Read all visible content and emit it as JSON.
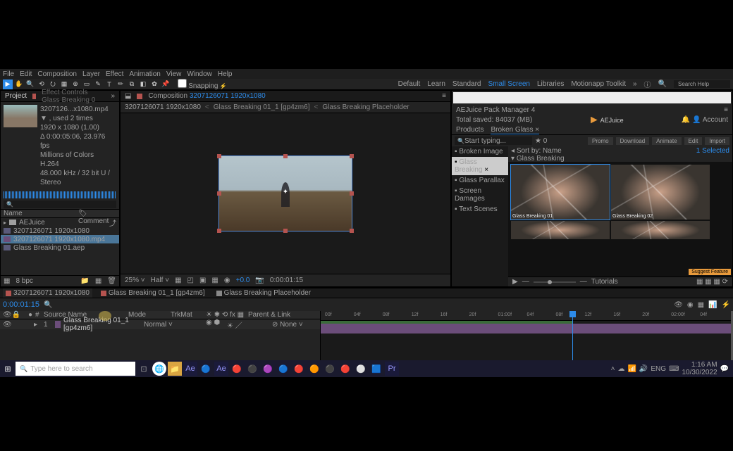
{
  "menu": {
    "file": "File",
    "edit": "Edit",
    "composition": "Composition",
    "layer": "Layer",
    "effect": "Effect",
    "animation": "Animation",
    "view": "View",
    "window": "Window",
    "help": "Help"
  },
  "workspace": {
    "default": "Default",
    "learn": "Learn",
    "standard": "Standard",
    "small_screen": "Small Screen",
    "libraries": "Libraries",
    "motionapp": "Motionapp Toolkit"
  },
  "search_help": "Search Help",
  "snapping": "Snapping",
  "project": {
    "tab1": "Project",
    "tab2": "Effect Controls Glass Breaking 0",
    "asset_name": "3207126...x1080.mp4 ▼ , used 2 times",
    "asset_res": "1920 x 1080 (1.00)",
    "asset_dur": "Δ 0:00:05:06, 23.976 fps",
    "asset_colors": "Millions of Colors",
    "asset_codec": "H.264",
    "asset_audio": "48.000 kHz / 32 bit U / Stereo",
    "col_name": "Name",
    "col_comment": "Comment",
    "items": [
      {
        "name": "AEJuice",
        "type": "folder"
      },
      {
        "name": "3207126071 1920x1080",
        "type": "comp"
      },
      {
        "name": "3207126071 1920x1080.mp4",
        "type": "video",
        "selected": true
      },
      {
        "name": "Glass Breaking 01.aep",
        "type": "comp"
      }
    ],
    "footer_bpc": "8 bpc"
  },
  "composition": {
    "tab_prefix": "Composition",
    "tab_name": "3207126071 1920x1080",
    "crumb1": "3207126071 1920x1080",
    "crumb2": "Glass Breaking 01_1 [gp4zm6]",
    "crumb3": "Glass Breaking Placeholder",
    "zoom": "25%",
    "res": "Half",
    "ratio": "+0.0",
    "timecode": "0:00:01:15"
  },
  "aejuice": {
    "title": "AEJuice Pack Manager 4",
    "savings": "Total saved: 84037 (MB)",
    "account": "Account",
    "tab_products": "Products",
    "tab_broken": "Broken Glass",
    "search_ph": "Start typing...",
    "star": "★ 0",
    "btn_promo": "Promo",
    "btn_download": "Download",
    "btn_animate": "Animate",
    "btn_edit": "Edit",
    "btn_import": "Import",
    "sidebar": [
      {
        "name": "Broken Image"
      },
      {
        "name": "Glass Breaking",
        "selected": true
      },
      {
        "name": "Glass Parallax"
      },
      {
        "name": "Screen Damages"
      },
      {
        "name": "Text Scenes"
      }
    ],
    "sort": "Sort by: Name",
    "group": "Glass Breaking",
    "selected": "1 Selected",
    "items": [
      "Glass Breaking 01",
      "Glass Breaking 02",
      "",
      ""
    ],
    "suggest": "Suggest Feature",
    "tutorials": "Tutorials"
  },
  "timeline": {
    "tabs": [
      {
        "name": "3207126071 1920x1080",
        "icon": "org",
        "active": true
      },
      {
        "name": "Glass Breaking 01_1 [gp4zm6]",
        "icon": "org"
      },
      {
        "name": "Glass Breaking Placeholder",
        "icon": "gry"
      }
    ],
    "timecode": "0:00:01:15",
    "col_source": "Source Name",
    "col_mode": "Mode",
    "col_trkmat": "TrkMat",
    "col_parent": "Parent & Link",
    "layer_num": "1",
    "layer_name": "Glass Breaking 01_1 [gp4zm6]",
    "layer_mode": "Normal",
    "layer_parent": "None",
    "ticks": [
      "00f",
      "04f",
      "08f",
      "12f",
      "16f",
      "20f",
      "01:00f",
      "04f",
      "08f",
      "12f",
      "16f",
      "20f",
      "02:00f",
      "04f"
    ]
  },
  "taskbar": {
    "search_ph": "Type here to search",
    "lang": "ENG",
    "time": "1:16 AM",
    "date": "10/30/2022"
  },
  "watermark": "AEJuice"
}
